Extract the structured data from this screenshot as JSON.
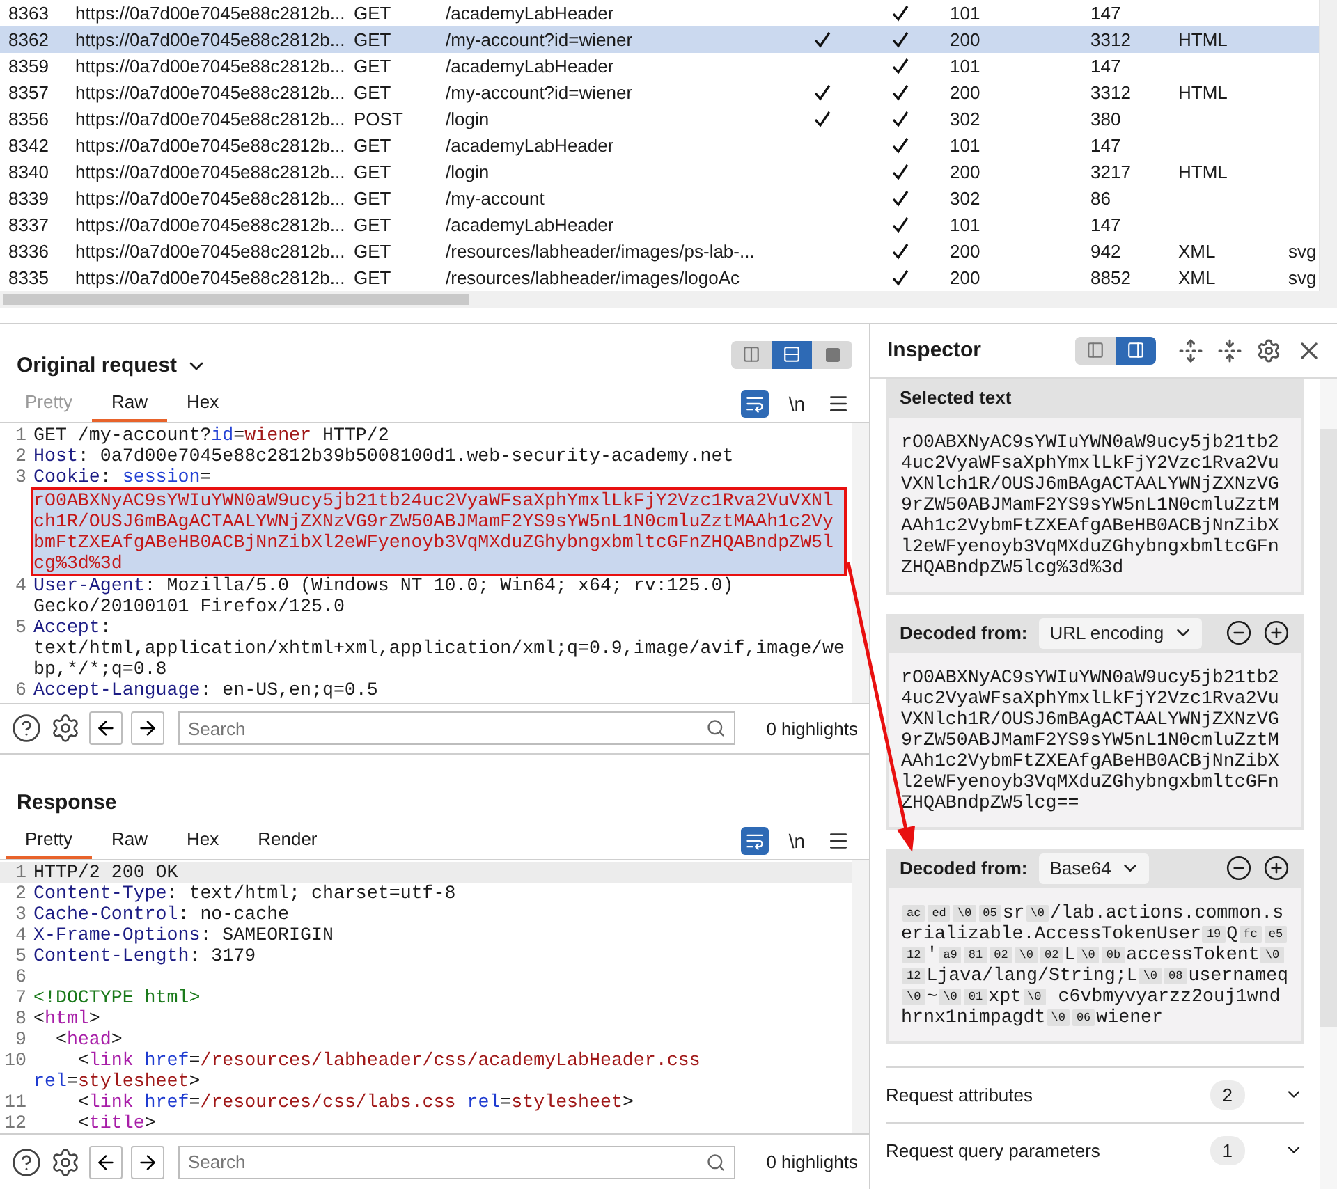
{
  "history_table": {
    "rows": [
      {
        "number": "8363",
        "url": "https://0a7d00e7045e88c2812b...",
        "method": "GET",
        "path": "/academyLabHeader",
        "check_1": false,
        "check_2": true,
        "status": "101",
        "length": "147",
        "selected": false
      },
      {
        "number": "8362",
        "url": "https://0a7d00e7045e88c2812b...",
        "method": "GET",
        "path": "/my-account?id=wiener",
        "check_1": true,
        "check_2": true,
        "status": "200",
        "length": "3312",
        "mime": "HTML",
        "selected": true
      },
      {
        "number": "8359",
        "url": "https://0a7d00e7045e88c2812b...",
        "method": "GET",
        "path": "/academyLabHeader",
        "check_1": false,
        "check_2": true,
        "status": "101",
        "length": "147",
        "selected": false
      },
      {
        "number": "8357",
        "url": "https://0a7d00e7045e88c2812b...",
        "method": "GET",
        "path": "/my-account?id=wiener",
        "check_1": true,
        "check_2": true,
        "status": "200",
        "length": "3312",
        "mime": "HTML",
        "selected": false
      },
      {
        "number": "8356",
        "url": "https://0a7d00e7045e88c2812b...",
        "method": "POST",
        "path": "/login",
        "check_1": true,
        "check_2": true,
        "status": "302",
        "length": "380",
        "selected": false
      },
      {
        "number": "8342",
        "url": "https://0a7d00e7045e88c2812b...",
        "method": "GET",
        "path": "/academyLabHeader",
        "check_1": false,
        "check_2": true,
        "status": "101",
        "length": "147",
        "selected": false
      },
      {
        "number": "8340",
        "url": "https://0a7d00e7045e88c2812b...",
        "method": "GET",
        "path": "/login",
        "check_1": false,
        "check_2": true,
        "status": "200",
        "length": "3217",
        "mime": "HTML",
        "selected": false
      },
      {
        "number": "8339",
        "url": "https://0a7d00e7045e88c2812b...",
        "method": "GET",
        "path": "/my-account",
        "check_1": false,
        "check_2": true,
        "status": "302",
        "length": "86",
        "selected": false
      },
      {
        "number": "8337",
        "url": "https://0a7d00e7045e88c2812b...",
        "method": "GET",
        "path": "/academyLabHeader",
        "check_1": false,
        "check_2": true,
        "status": "101",
        "length": "147",
        "selected": false
      },
      {
        "number": "8336",
        "url": "https://0a7d00e7045e88c2812b...",
        "method": "GET",
        "path": "/resources/labheader/images/ps-lab-...",
        "check_1": false,
        "check_2": true,
        "status": "200",
        "length": "942",
        "mime": "XML",
        "extension": "svg",
        "selected": false
      },
      {
        "number": "8335",
        "url": "https://0a7d00e7045e88c2812b...",
        "method": "GET",
        "path": "/resources/labheader/images/logoAc",
        "check_1": false,
        "check_2": true,
        "status": "200",
        "length": "8852",
        "mime": "XML",
        "extension": "svg",
        "selected": false
      }
    ]
  },
  "request": {
    "title": "Original request",
    "view_buttons": [
      {
        "kind": "columns",
        "selected": false
      },
      {
        "kind": "rows",
        "selected": true
      },
      {
        "kind": "single",
        "selected": false
      }
    ],
    "tabs": [
      {
        "label": "Pretty",
        "selected": false,
        "disabled": true
      },
      {
        "label": "Raw",
        "selected": true,
        "disabled": false
      },
      {
        "label": "Hex",
        "selected": false,
        "disabled": false
      }
    ],
    "newline_toggle": "\\n",
    "lines": [
      {
        "number": "1",
        "current": false,
        "segments": [
          {
            "kind": "plain",
            "text": "GET /my-account?"
          },
          {
            "kind": "param",
            "text": "id"
          },
          {
            "kind": "plain",
            "text": "="
          },
          {
            "kind": "value",
            "text": "wiener"
          },
          {
            "kind": "plain",
            "text": " HTTP/2"
          }
        ]
      },
      {
        "number": "2",
        "current": false,
        "segments": [
          {
            "kind": "key",
            "text": "Host"
          },
          {
            "kind": "plain",
            "text": ": 0a7d00e7045e88c2812b39b5008100d1.web-security-academy.net"
          }
        ]
      },
      {
        "number": "3",
        "current": false,
        "segments": [
          {
            "kind": "key",
            "text": "Cookie"
          },
          {
            "kind": "plain",
            "text": ": "
          },
          {
            "kind": "param",
            "text": "session"
          },
          {
            "kind": "plain",
            "text": "="
          },
          {
            "kind": "selection",
            "text": "rO0ABXNyAC9sYWIuYWN0aW9ucy5jb21tb24uc2VyaWFsaXphYmxlLkFjY2Vzc1Rva2VuVXNlch1R/OUSJ6mBAgACTAALYWNjZXNzVG9rZW50ABJMamF2YS9sYW5nL1N0cmluZztMAAh1c2VybmFtZXEAfgABeHB0ACBjNnZibXl2eWFyenoyb3VqMXduZGhybngxbmltcGFnZHQABndpZW5lcg%3d%3d"
          }
        ]
      },
      {
        "number": "4",
        "current": false,
        "segments": [
          {
            "kind": "key",
            "text": "User-Agent"
          },
          {
            "kind": "plain",
            "text": ": Mozilla/5.0 (Windows NT 10.0; Win64; x64; rv:125.0) Gecko/20100101 Firefox/125.0"
          }
        ]
      },
      {
        "number": "5",
        "current": false,
        "segments": [
          {
            "kind": "key",
            "text": "Accept"
          },
          {
            "kind": "plain",
            "text": ": text/html,application/xhtml+xml,application/xml;q=0.9,image/avif,image/webp,*/*;q=0.8"
          }
        ]
      },
      {
        "number": "6",
        "current": false,
        "segments": [
          {
            "kind": "key",
            "text": "Accept-Language"
          },
          {
            "kind": "plain",
            "text": ": en-US,en;q=0.5"
          }
        ]
      }
    ],
    "search": {
      "placeholder": "Search"
    },
    "highlights": "0 highlights"
  },
  "response": {
    "title": "Response",
    "tabs": [
      {
        "label": "Pretty",
        "selected": true,
        "disabled": false
      },
      {
        "label": "Raw",
        "selected": false,
        "disabled": false
      },
      {
        "label": "Hex",
        "selected": false,
        "disabled": false
      },
      {
        "label": "Render",
        "selected": false,
        "disabled": false
      }
    ],
    "newline_toggle": "\\n",
    "lines": [
      {
        "number": "1",
        "current": true,
        "segments": [
          {
            "kind": "plain",
            "text": "HTTP/2 200 OK"
          }
        ]
      },
      {
        "number": "2",
        "current": false,
        "segments": [
          {
            "kind": "key",
            "text": "Content-Type"
          },
          {
            "kind": "plain",
            "text": ": text/html; charset=utf-8"
          }
        ]
      },
      {
        "number": "3",
        "current": false,
        "segments": [
          {
            "kind": "key",
            "text": "Cache-Control"
          },
          {
            "kind": "plain",
            "text": ": no-cache"
          }
        ]
      },
      {
        "number": "4",
        "current": false,
        "segments": [
          {
            "kind": "key",
            "text": "X-Frame-Options"
          },
          {
            "kind": "plain",
            "text": ": SAMEORIGIN"
          }
        ]
      },
      {
        "number": "5",
        "current": false,
        "segments": [
          {
            "kind": "key",
            "text": "Content-Length"
          },
          {
            "kind": "plain",
            "text": ": 3179"
          }
        ]
      },
      {
        "number": "6",
        "current": false
      },
      {
        "number": "7",
        "current": false,
        "segments": [
          {
            "kind": "doctype",
            "text": "<!DOCTYPE html>"
          }
        ]
      },
      {
        "number": "8",
        "current": false,
        "segments": [
          {
            "kind": "plain",
            "text": "<"
          },
          {
            "kind": "tag",
            "text": "html"
          },
          {
            "kind": "plain",
            "text": ">"
          }
        ]
      },
      {
        "number": "9",
        "current": false,
        "segments": [
          {
            "kind": "plain",
            "text": "  <"
          },
          {
            "kind": "tag",
            "text": "head"
          },
          {
            "kind": "plain",
            "text": ">"
          }
        ]
      },
      {
        "number": "10",
        "current": false,
        "segments": [
          {
            "kind": "plain",
            "text": "    <"
          },
          {
            "kind": "tag",
            "text": "link"
          },
          {
            "kind": "attr",
            "text": " href"
          },
          {
            "kind": "plain",
            "text": "="
          },
          {
            "kind": "value",
            "text": "/resources/labheader/css/academyLabHeader.css"
          },
          {
            "kind": "attr",
            "text": " rel"
          },
          {
            "kind": "plain",
            "text": "="
          },
          {
            "kind": "value",
            "text": "stylesheet"
          },
          {
            "kind": "plain",
            "text": ">"
          }
        ]
      },
      {
        "number": "11",
        "current": false,
        "segments": [
          {
            "kind": "plain",
            "text": "    <"
          },
          {
            "kind": "tag",
            "text": "link"
          },
          {
            "kind": "attr",
            "text": " href"
          },
          {
            "kind": "plain",
            "text": "="
          },
          {
            "kind": "value",
            "text": "/resources/css/labs.css"
          },
          {
            "kind": "attr",
            "text": " rel"
          },
          {
            "kind": "plain",
            "text": "="
          },
          {
            "kind": "value",
            "text": "stylesheet"
          },
          {
            "kind": "plain",
            "text": ">"
          }
        ]
      },
      {
        "number": "12",
        "current": false,
        "segments": [
          {
            "kind": "plain",
            "text": "    <"
          },
          {
            "kind": "tag",
            "text": "title"
          },
          {
            "kind": "plain",
            "text": ">"
          }
        ]
      }
    ],
    "search": {
      "placeholder": "Search"
    },
    "highlights": "0 highlights"
  },
  "inspector": {
    "title": "Inspector",
    "view_buttons": [
      {
        "kind": "pane-left",
        "selected": false
      },
      {
        "kind": "pane-right",
        "selected": true
      }
    ],
    "sections": [
      {
        "kind": "selected",
        "title": "Selected text",
        "text": "rO0ABXNyAC9sYWIuYWN0aW9ucy5jb21tb24uc2VyaWFsaXphYmxlLkFjY2Vzc1Rva2VuVXNlch1R/OUSJ6mBAgACTAALYWNjZXNzVG9rZW50ABJMamF2YS9sYW5nL1N0cmluZztMAAh1c2VybmFtZXEAfgABeHB0ACBjNnZibXl2eWFyenoyb3VqMXduZGhybngxbmltcGFnZHQABndpZW5lcg%3d%3d"
      },
      {
        "kind": "decoded",
        "title": "Decoded from:",
        "encoding": "URL encoding",
        "text": "rO0ABXNyAC9sYWIuYWN0aW9ucy5jb21tb24uc2VyaWFsaXphYmxlLkFjY2Vzc1Rva2VuVXNlch1R/OUSJ6mBAgACTAALYWNjZXNzVG9rZW50ABJMamF2YS9sYW5nL1N0cmluZztMAAh1c2VybmFtZXEAfgABeHB0ACBjNnZibXl2eWFyenoyb3VqMXduZGhybngxbmltcGFnZHQABndpZW5lcg=="
      },
      {
        "kind": "decoded",
        "title": "Decoded from:",
        "encoding": "Base64",
        "segments": [
          {
            "kind": "byte",
            "text": "ac"
          },
          {
            "kind": "byte",
            "text": "ed"
          },
          {
            "kind": "byte",
            "text": "\\0"
          },
          {
            "kind": "byte",
            "text": "05"
          },
          {
            "kind": "text",
            "text": "sr"
          },
          {
            "kind": "byte",
            "text": "\\0"
          },
          {
            "kind": "text",
            "text": "/lab.actions.common.serializable.AccessTokenUser"
          },
          {
            "kind": "byte",
            "text": "19"
          },
          {
            "kind": "text",
            "text": "Q"
          },
          {
            "kind": "byte",
            "text": "fc"
          },
          {
            "kind": "byte",
            "text": "e5"
          },
          {
            "kind": "byte",
            "text": "12"
          },
          {
            "kind": "text",
            "text": "'"
          },
          {
            "kind": "byte",
            "text": "a9"
          },
          {
            "kind": "byte",
            "text": "81"
          },
          {
            "kind": "byte",
            "text": "02"
          },
          {
            "kind": "byte",
            "text": "\\0"
          },
          {
            "kind": "byte",
            "text": "02"
          },
          {
            "kind": "text",
            "text": "L"
          },
          {
            "kind": "byte",
            "text": "\\0"
          },
          {
            "kind": "byte",
            "text": "0b"
          },
          {
            "kind": "text",
            "text": "accessTokent"
          },
          {
            "kind": "byte",
            "text": "\\0"
          },
          {
            "kind": "byte",
            "text": "12"
          },
          {
            "kind": "text",
            "text": "Ljava/lang/String;L"
          },
          {
            "kind": "byte",
            "text": "\\0"
          },
          {
            "kind": "byte",
            "text": "08"
          },
          {
            "kind": "text",
            "text": "usernameq"
          },
          {
            "kind": "byte",
            "text": "\\0"
          },
          {
            "kind": "text",
            "text": "~"
          },
          {
            "kind": "byte",
            "text": "\\0"
          },
          {
            "kind": "byte",
            "text": "01"
          },
          {
            "kind": "text",
            "text": "xpt"
          },
          {
            "kind": "byte",
            "text": "\\0"
          },
          {
            "kind": "text",
            "text": " c6vbmyvyarzz2ouj1wndhrnx1nimpagdt"
          },
          {
            "kind": "byte",
            "text": "\\0"
          },
          {
            "kind": "byte",
            "text": "06"
          },
          {
            "kind": "text",
            "text": "wiener"
          }
        ]
      }
    ],
    "groups": [
      {
        "label": "Request attributes",
        "count": "2",
        "expanded": false
      },
      {
        "label": "Request query parameters",
        "count": "1",
        "expanded": false
      }
    ]
  }
}
